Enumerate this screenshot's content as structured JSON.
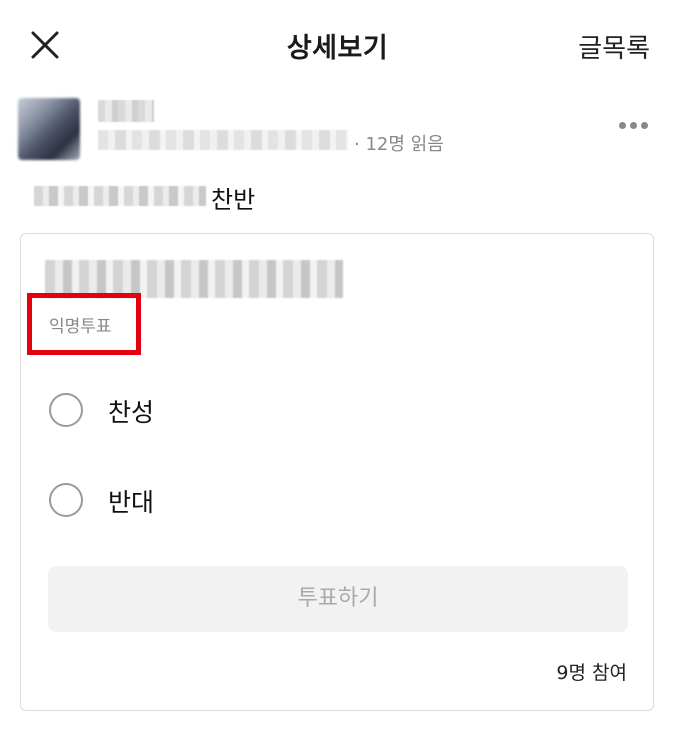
{
  "header": {
    "title": "상세보기",
    "list_label": "글목록"
  },
  "post": {
    "read_count": "· 12명 읽음",
    "content_tail": "찬반"
  },
  "poll": {
    "anon_tag": "익명투표",
    "options": [
      {
        "label": "찬성",
        "selected": false
      },
      {
        "label": "반대",
        "selected": false
      }
    ],
    "vote_button": "투표하기",
    "participants": "9명 참여"
  },
  "colors": {
    "highlight": "#e3000f",
    "muted_text": "#888888",
    "button_bg": "#f2f2f2"
  },
  "icons": {
    "close": "close-icon",
    "more": "more-horizontal-icon"
  }
}
